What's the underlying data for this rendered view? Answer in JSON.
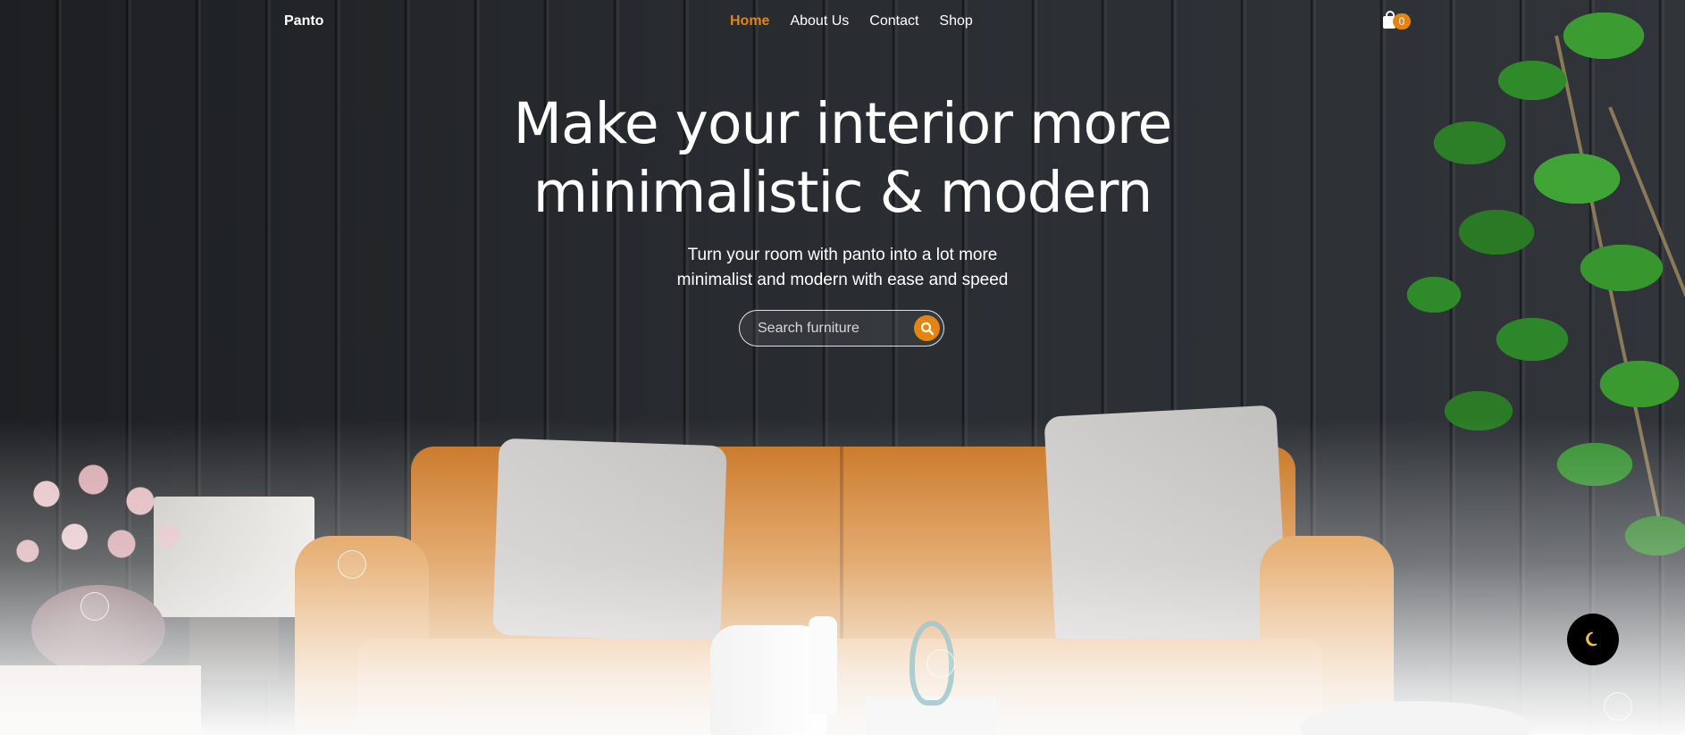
{
  "brand": {
    "name": "Panto"
  },
  "nav": {
    "links": [
      {
        "label": "Home",
        "active": true
      },
      {
        "label": "About Us",
        "active": false
      },
      {
        "label": "Contact",
        "active": false
      },
      {
        "label": "Shop",
        "active": false
      }
    ]
  },
  "cart": {
    "icon": "shopping-bag-icon",
    "count": "0"
  },
  "hero": {
    "headline_line1": "Make your interior more",
    "headline_line2": "minimalistic & modern",
    "subline_line1": "Turn your room with panto into a lot more",
    "subline_line2": "minimalist and modern with ease and speed"
  },
  "search": {
    "placeholder": "Search furniture",
    "value": "",
    "icon": "search-icon"
  },
  "theme_toggle": {
    "icon": "moon-icon"
  },
  "colors": {
    "accent": "#e58411",
    "text": "#ffffff",
    "wall": "#26292d",
    "toggle_bg": "#000000",
    "moon": "#f2c230"
  }
}
